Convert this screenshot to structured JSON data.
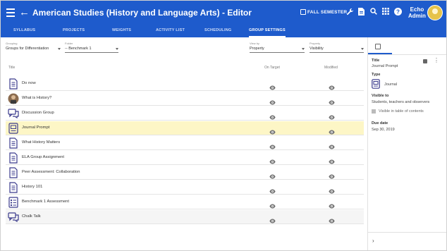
{
  "header": {
    "title": "American Studies (History and Language Arts) - Editor",
    "semester": "FALL SEMESTER",
    "user_first": "Echo",
    "user_last": "Admin"
  },
  "tabs": [
    {
      "label": "SYLLABUS"
    },
    {
      "label": "PROJECTS"
    },
    {
      "label": "WEIGHTS"
    },
    {
      "label": "ACTIVITY LIST"
    },
    {
      "label": "SCHEDULING"
    },
    {
      "label": "GROUP SETTINGS",
      "active": true
    }
  ],
  "filters": {
    "grouping": {
      "label": "Grouping",
      "value": "Groups for Differentiation"
    },
    "folder": {
      "label": "Folder",
      "value": "-- Benchmark 1"
    },
    "view_by": {
      "label": "View by",
      "value": "Property"
    },
    "property": {
      "label": "Property",
      "value": "Visibility"
    }
  },
  "table": {
    "columns": {
      "title": "Title",
      "on_target": "On Target",
      "modified": "Modified"
    },
    "rows": [
      {
        "title": "Do now",
        "icon": "document-icon"
      },
      {
        "title": "What is History?",
        "icon": "image-icon"
      },
      {
        "title": "Discussion Group",
        "icon": "discussion-icon"
      },
      {
        "title": "Journal Prompt",
        "icon": "journal-icon",
        "selected": true
      },
      {
        "title": "What History Matters",
        "icon": "document-icon"
      },
      {
        "title": "ELA Group Assignment",
        "icon": "document-icon"
      },
      {
        "title": "Peer Assessment: Collaboration",
        "icon": "document-icon"
      },
      {
        "title": "History 101",
        "icon": "document-icon"
      },
      {
        "title": "Benchmark 1 Assessment",
        "icon": "checklist-icon"
      },
      {
        "title": "Chalk Talk",
        "icon": "discussion-icon"
      }
    ]
  },
  "details": {
    "title_label": "Title",
    "title_value": "Journal Prompt",
    "type_label": "Type",
    "type_value": "Journal",
    "visible_label": "Visible to",
    "visible_value": "Students, teachers and observers",
    "toc_label": "Visible in table of contents",
    "due_label": "Due date",
    "due_value": "Sep 30, 2019"
  },
  "colors": {
    "primary": "#1e5bcc",
    "highlight": "#fdf6c6",
    "icon": "#3a3a8c"
  }
}
